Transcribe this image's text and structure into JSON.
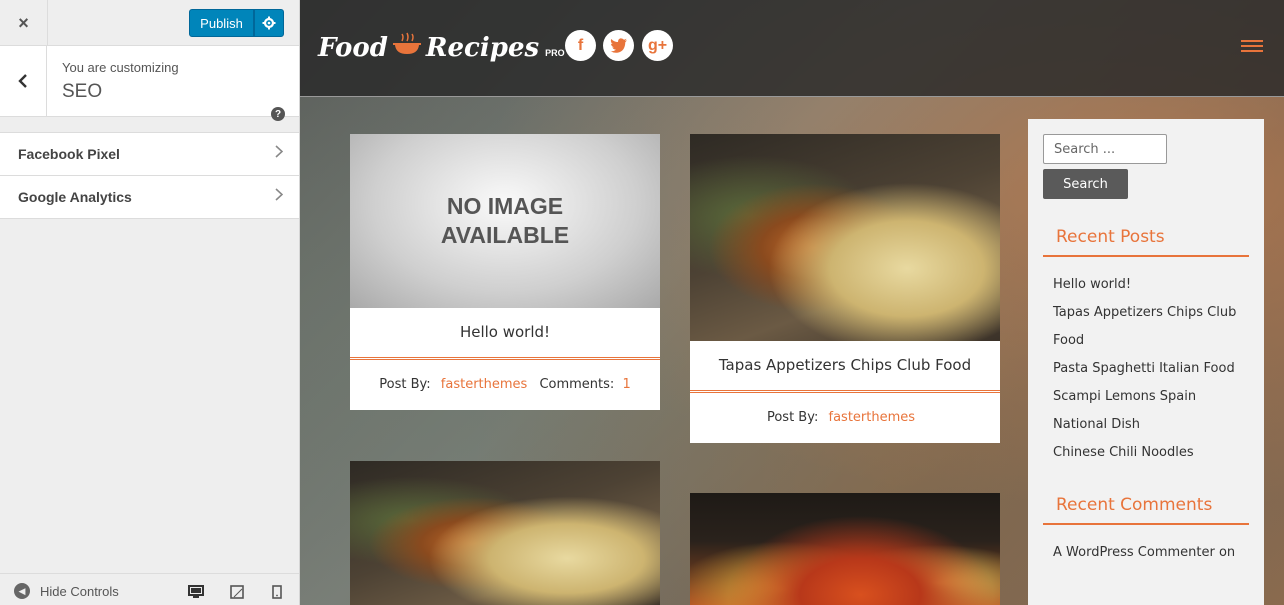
{
  "customizer": {
    "close_icon": "×",
    "publish_label": "Publish",
    "customizing_label": "You are customizing",
    "section_title": "SEO",
    "help_label": "?",
    "panels": [
      {
        "label": "Facebook Pixel"
      },
      {
        "label": "Google Analytics"
      }
    ],
    "hide_controls_label": "Hide Controls"
  },
  "site": {
    "logo": {
      "word1": "Food",
      "word2": "Recipes",
      "pro": "PRO"
    },
    "social": {
      "facebook": "f",
      "twitter": "t",
      "googleplus": "g+"
    }
  },
  "posts": [
    {
      "title": "Hello world!",
      "post_by_label": "Post By:",
      "author": "fasterthemes",
      "comments_label": "Comments:",
      "comments": "1",
      "no_image_text": "NO IMAGE AVAILABLE"
    },
    {
      "title": "Tapas Appetizers Chips Club Food",
      "post_by_label": "Post By:",
      "author": "fasterthemes"
    }
  ],
  "widgets": {
    "search_placeholder": "Search ...",
    "search_button": "Search",
    "recent_posts_title": "Recent Posts",
    "recent_posts": [
      "Hello world!",
      "Tapas Appetizers Chips Club Food",
      "Pasta Spaghetti Italian Food",
      "Scampi Lemons Spain",
      "National Dish",
      "Chinese Chili Noodles"
    ],
    "recent_comments_title": "Recent Comments",
    "recent_comments": [
      "A WordPress Commenter on"
    ]
  },
  "colors": {
    "accent": "#e8743b",
    "publish": "#0085ba"
  },
  "icons": [
    "close-icon",
    "gear-icon",
    "back-arrow-icon",
    "help-icon",
    "chevron-right-icon",
    "hide-controls-icon",
    "desktop-icon",
    "tablet-icon",
    "mobile-icon",
    "facebook-icon",
    "twitter-icon",
    "google-plus-icon",
    "menu-icon"
  ]
}
